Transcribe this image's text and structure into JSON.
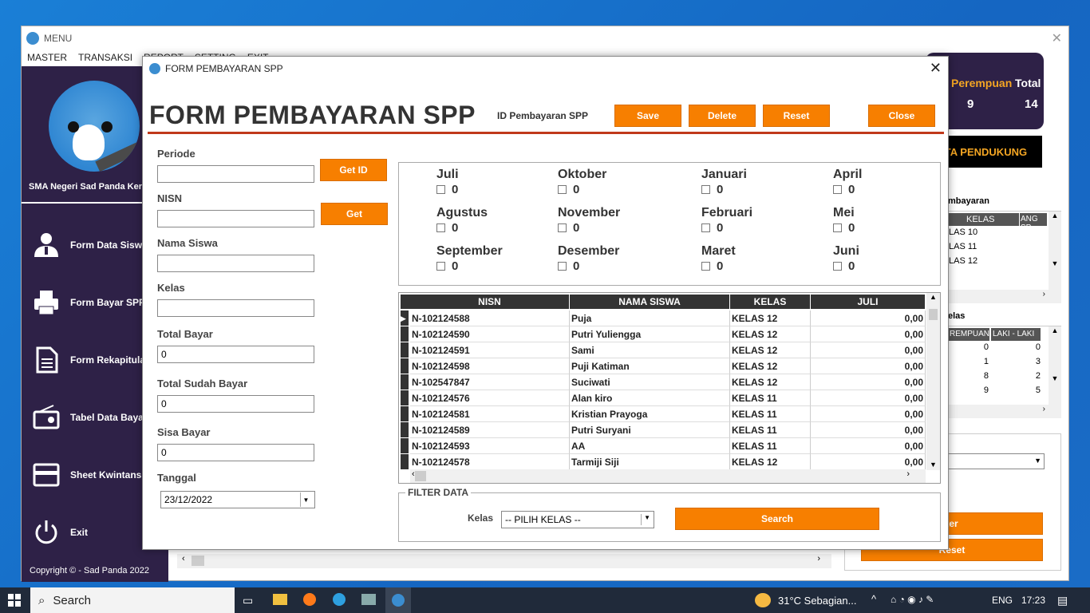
{
  "main_window": {
    "title": "MENU",
    "menu": [
      "MASTER",
      "TRANSAKSI",
      "REPORT",
      "SETTING",
      "EXIT"
    ]
  },
  "sidebar": {
    "school": "SMA Negeri Sad Panda Kert",
    "items": [
      {
        "label": "Form Data Siswa",
        "icon": "user-icon"
      },
      {
        "label": "Form Bayar SPP",
        "icon": "printer-icon"
      },
      {
        "label": "Form Rekapitulasi",
        "icon": "document-icon"
      },
      {
        "label": "Tabel Data Bayar",
        "icon": "radio-icon"
      },
      {
        "label": "Sheet Kwintansi",
        "icon": "card-icon"
      },
      {
        "label": "Exit",
        "icon": "power-icon"
      }
    ],
    "copyright": "Copyright © - Sad Panda 2022"
  },
  "right_panel": {
    "perempuan_label": "Perempuan",
    "perempuan_value": "9",
    "total_label": "Total",
    "total_value": "14",
    "data_pendukung": "DATA PENDUKUNG",
    "table1_caption": "mbayaran",
    "table1_headers": [
      "KELAS",
      "ANG SP"
    ],
    "table1_rows": [
      "LAS 10",
      "LAS 11",
      "LAS 12"
    ],
    "table2_caption": "elas",
    "table2_headers": [
      "REMPUAN",
      "LAKI - LAKI"
    ],
    "table2_rows": [
      [
        "0",
        "0"
      ],
      [
        "1",
        "3"
      ],
      [
        "8",
        "2"
      ],
      [
        "9",
        "5"
      ]
    ],
    "filter_btn": "ter",
    "reset_btn": "Reset"
  },
  "dialog": {
    "title": "FORM PEMBAYARAN SPP",
    "heading": "FORM PEMBAYARAN SPP",
    "id_label": "ID Pembayaran SPP",
    "buttons": {
      "save": "Save",
      "delete": "Delete",
      "reset": "Reset",
      "close": "Close",
      "get_id": "Get ID",
      "get": "Get"
    },
    "fields": {
      "periode": "Periode",
      "nisn": "NISN",
      "nama": "Nama Siswa",
      "kelas": "Kelas",
      "total_bayar": "Total Bayar",
      "total_bayar_val": "0",
      "sudah_bayar": "Total Sudah Bayar",
      "sudah_bayar_val": "0",
      "sisa": "Sisa Bayar",
      "sisa_val": "0",
      "tanggal": "Tanggal",
      "tanggal_val": "23/12/2022"
    },
    "months": [
      {
        "name": "Juli",
        "val": "0"
      },
      {
        "name": "Oktober",
        "val": "0"
      },
      {
        "name": "Januari",
        "val": "0"
      },
      {
        "name": "April",
        "val": "0"
      },
      {
        "name": "Agustus",
        "val": "0"
      },
      {
        "name": "November",
        "val": "0"
      },
      {
        "name": "Februari",
        "val": "0"
      },
      {
        "name": "Mei",
        "val": "0"
      },
      {
        "name": "September",
        "val": "0"
      },
      {
        "name": "Desember",
        "val": "0"
      },
      {
        "name": "Maret",
        "val": "0"
      },
      {
        "name": "Juni",
        "val": "0"
      }
    ],
    "grid_headers": [
      "NISN",
      "NAMA SISWA",
      "KELAS",
      "JULI"
    ],
    "grid_rows": [
      [
        "N-102124588",
        "Puja",
        "KELAS 12",
        "0,00"
      ],
      [
        "N-102124590",
        "Putri Yuliengga",
        "KELAS 12",
        "0,00"
      ],
      [
        "N-102124591",
        "Sami",
        "KELAS 12",
        "0,00"
      ],
      [
        "N-102124598",
        "Puji Katiman",
        "KELAS 12",
        "0,00"
      ],
      [
        "N-102547847",
        "Suciwati",
        "KELAS 12",
        "0,00"
      ],
      [
        "N-102124576",
        "Alan kiro",
        "KELAS 11",
        "0,00"
      ],
      [
        "N-102124581",
        "Kristian Prayoga",
        "KELAS 11",
        "0,00"
      ],
      [
        "N-102124589",
        "Putri Suryani",
        "KELAS 11",
        "0,00"
      ],
      [
        "N-102124593",
        "AA",
        "KELAS 11",
        "0,00"
      ],
      [
        "N-102124578",
        "Tarmiji Siji",
        "KELAS 12",
        "0,00"
      ]
    ],
    "filter": {
      "title": "FILTER DATA",
      "kelas_label": "Kelas",
      "select_val": "-- PILIH KELAS --",
      "search": "Search"
    }
  },
  "taskbar": {
    "search": "Search",
    "weather": "31°C  Sebagian...",
    "lang": "ENG",
    "time": "17:23"
  }
}
